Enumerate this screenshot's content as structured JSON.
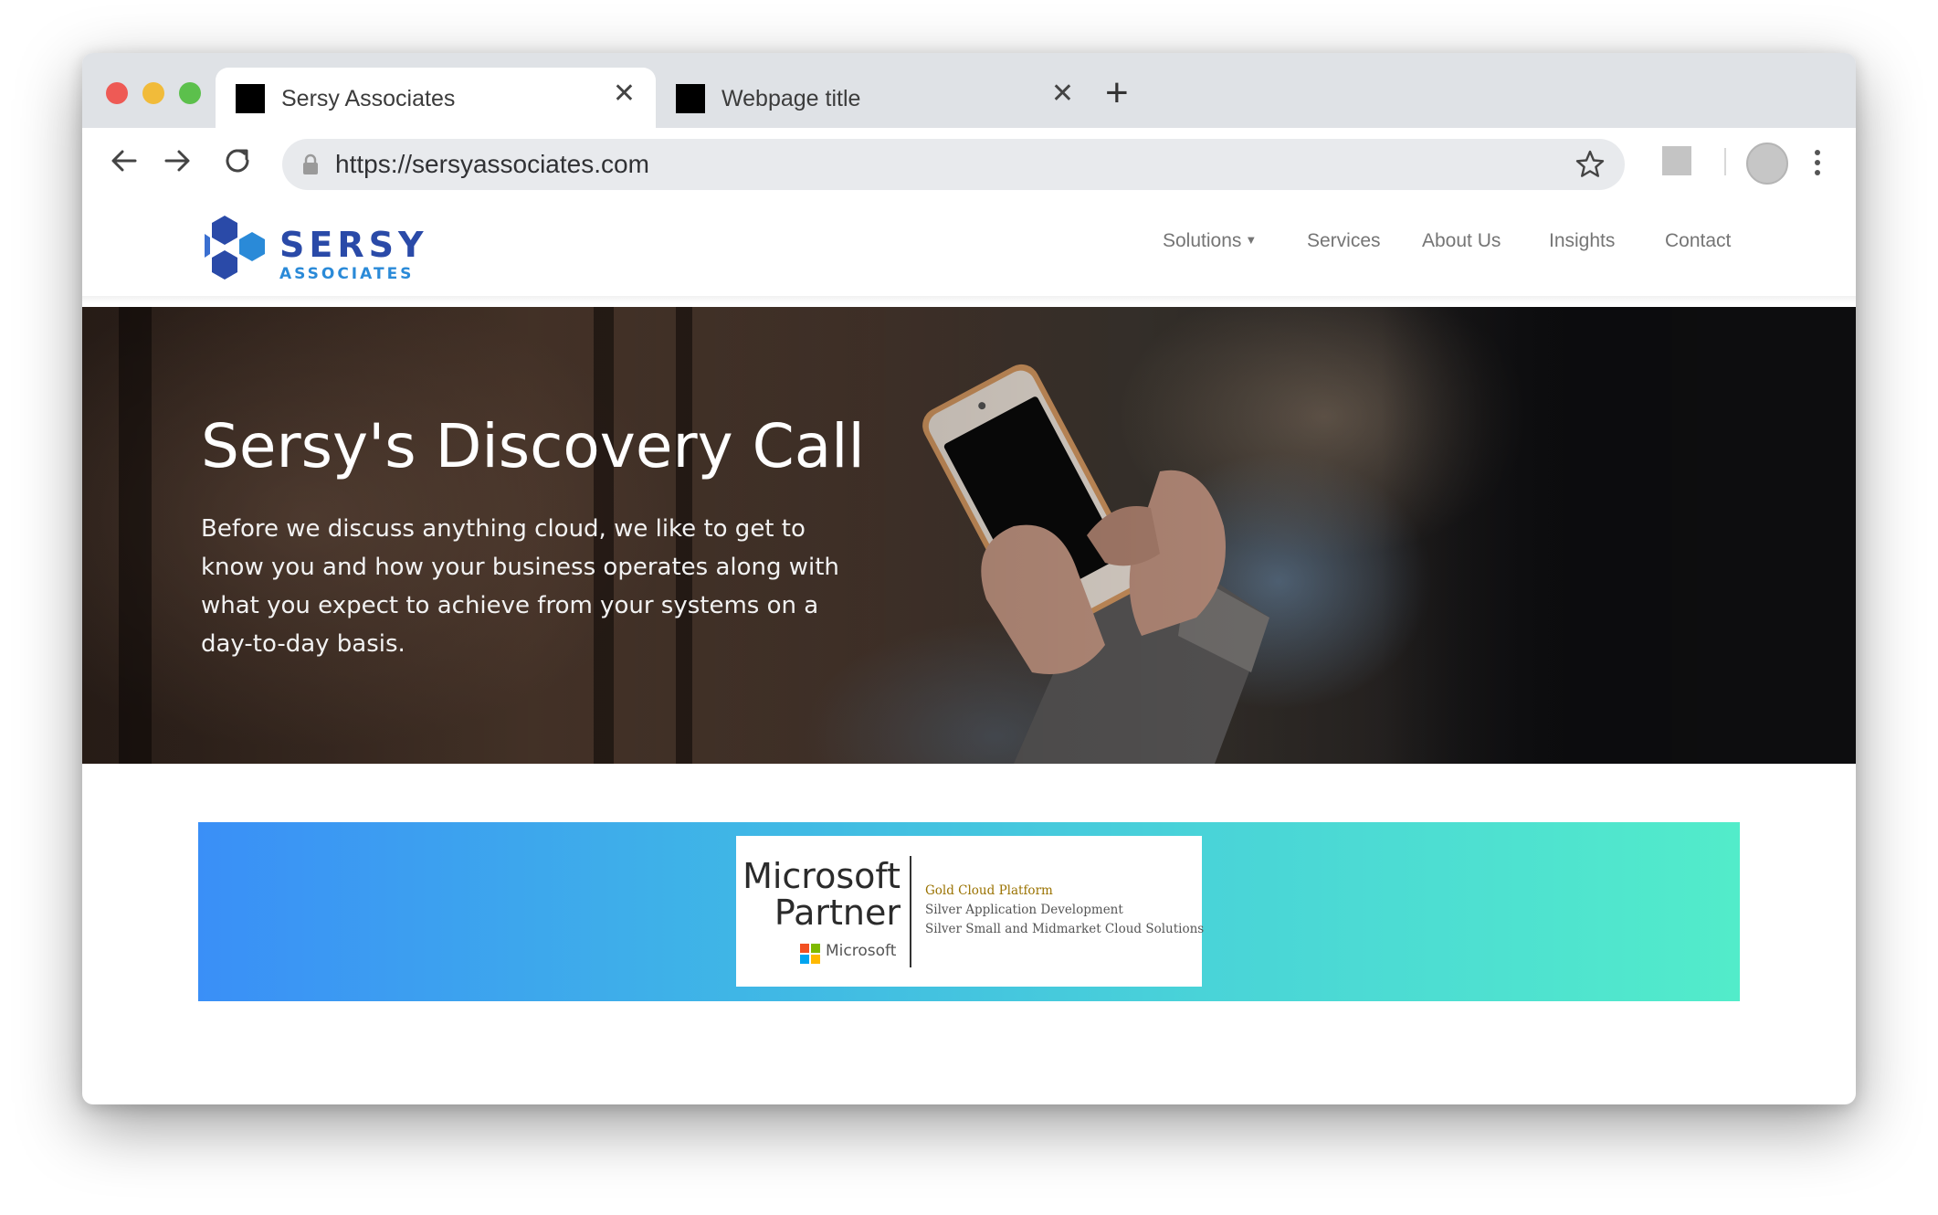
{
  "browser": {
    "tabs": [
      {
        "title": "Sersy Associates",
        "close": "✕"
      },
      {
        "title": "Webpage title",
        "close": "✕"
      }
    ],
    "new_tab": "+",
    "url": "https://sersyassociates.com"
  },
  "site": {
    "logo": {
      "line1": "SERSY",
      "line2": "ASSOCIATES"
    },
    "nav": [
      {
        "label": "Solutions",
        "caret": "▼"
      },
      {
        "label": "Services"
      },
      {
        "label": "About Us"
      },
      {
        "label": "Insights"
      },
      {
        "label": "Contact"
      }
    ],
    "hero": {
      "title": "Sersy's Discovery Call",
      "body": "Before we discuss anything cloud, we like to get to know you and how your business operates along with what you expect to achieve from your systems on a day-to-day basis."
    },
    "partner": {
      "line1": "Microsoft",
      "line2": "Partner",
      "logo_text": "Microsoft",
      "competencies": [
        "Gold Cloud Platform",
        "Silver Application Development",
        "Silver Small and Midmarket Cloud Solutions"
      ]
    }
  },
  "colors": {
    "logo_dark": "#2a4aa8",
    "logo_light": "#2a8ad8",
    "banner_start": "#3a8ff7",
    "banner_end": "#52ecca",
    "gold": "#9a7200"
  }
}
